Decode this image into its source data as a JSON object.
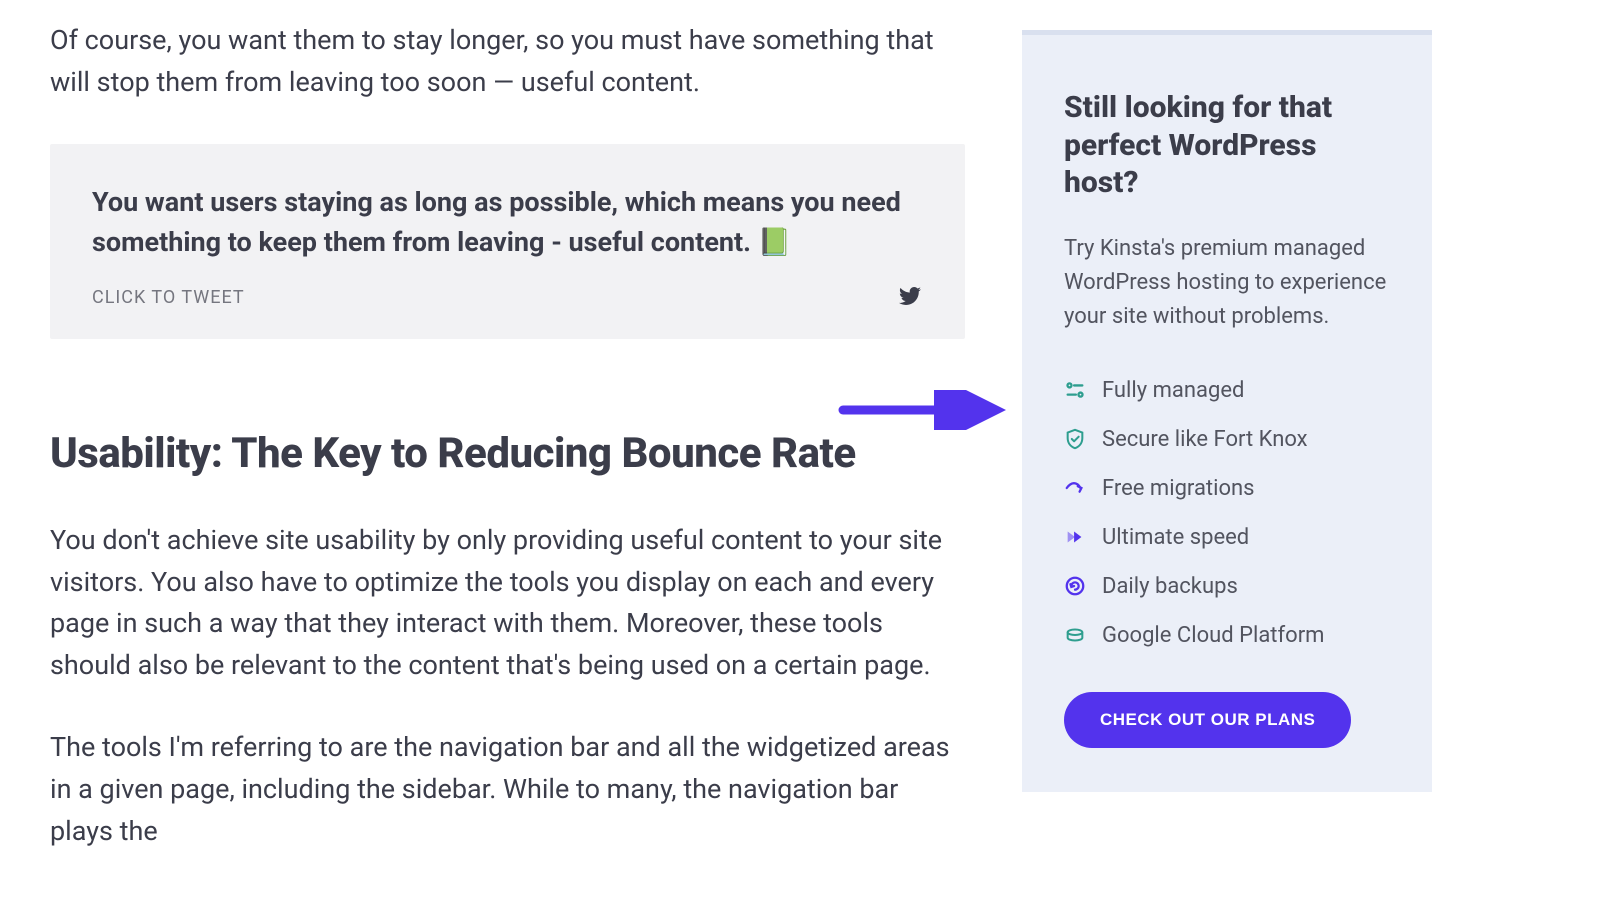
{
  "article": {
    "intro_paragraph": "Of course, you want them to stay longer, so you must have something that will stop them from leaving too soon — useful content.",
    "tweet_box": {
      "quote": "You want users staying as long as possible, which means you need something to keep them from leaving - useful content. 📗",
      "cta": "CLICK TO TWEET"
    },
    "section_heading": "Usability: The Key to Reducing Bounce Rate",
    "body_paragraph_1": "You don't achieve site usability by only providing useful content to your site visitors. You also have to optimize the tools you display on each and every page in such a way that they interact with them. Moreover, these tools should also be relevant to the content that's being used on a certain page.",
    "body_paragraph_2": "The tools I'm referring to are the navigation bar and all the widgetized areas in a given page, including the sidebar. While to many, the navigation bar plays the"
  },
  "sidebar": {
    "heading": "Still looking for that perfect WordPress host?",
    "paragraph": "Try Kinsta's premium managed WordPress hosting to experience your site without problems.",
    "features": [
      {
        "label": "Fully managed",
        "icon": "managed"
      },
      {
        "label": "Secure like Fort Knox",
        "icon": "shield"
      },
      {
        "label": "Free migrations",
        "icon": "migration"
      },
      {
        "label": "Ultimate speed",
        "icon": "speed"
      },
      {
        "label": "Daily backups",
        "icon": "backup"
      },
      {
        "label": "Google Cloud Platform",
        "icon": "cloud"
      }
    ],
    "cta_button": "CHECK OUT OUR PLANS"
  }
}
